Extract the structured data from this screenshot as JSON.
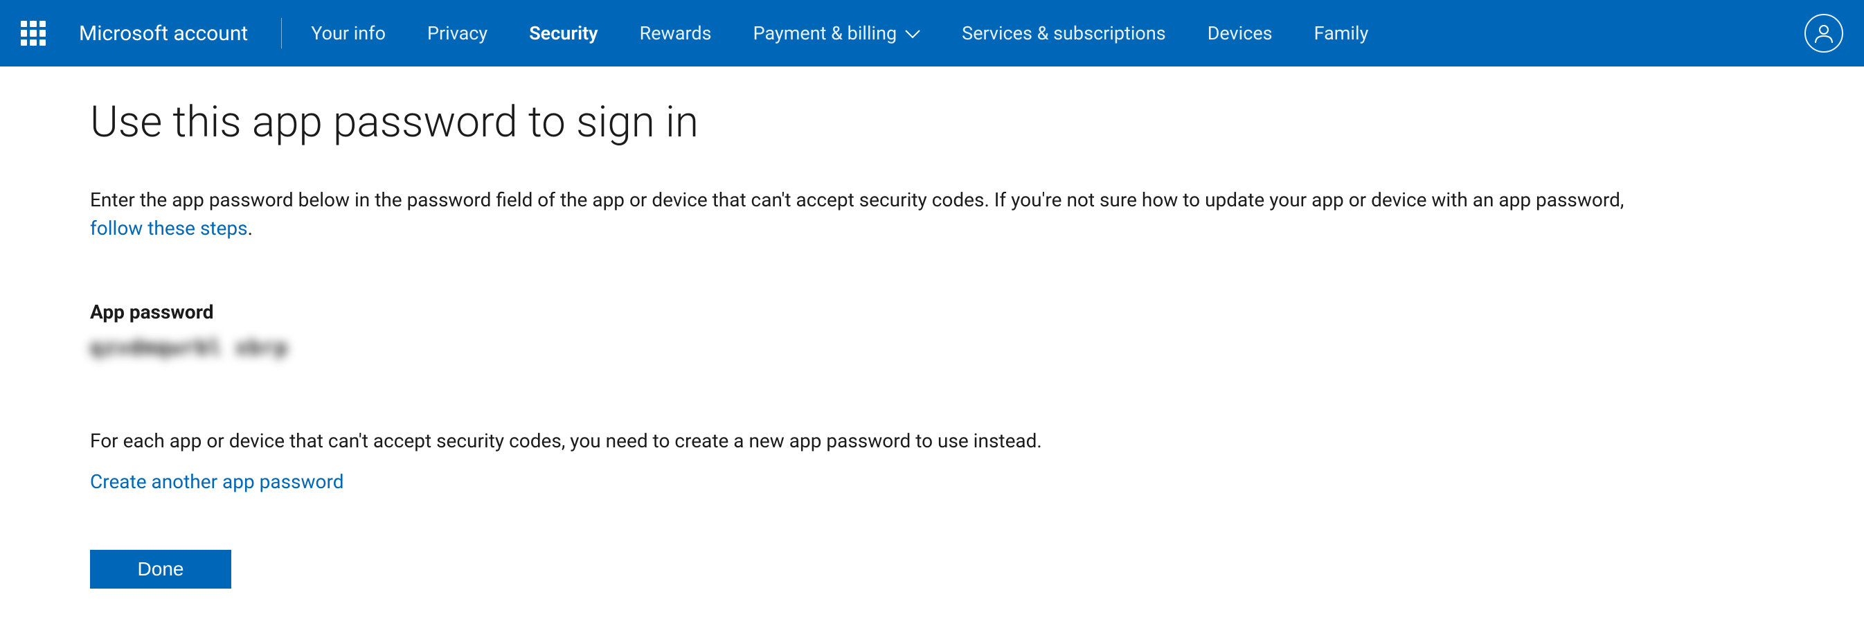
{
  "header": {
    "brand": "Microsoft account",
    "nav": {
      "your_info": "Your info",
      "privacy": "Privacy",
      "security": "Security",
      "rewards": "Rewards",
      "payment": "Payment & billing",
      "services": "Services & subscriptions",
      "devices": "Devices",
      "family": "Family"
    }
  },
  "main": {
    "title": "Use this app password to sign in",
    "intro_text": "Enter the app password below in the password field of the app or device that can't accept security codes. If you're not sure how to update your app or device with an app password, ",
    "intro_link": "follow these steps",
    "intro_period": ".",
    "password_label": "App password",
    "password_value": "qzvdmqwrbl xbrp",
    "note": "For each app or device that can't accept security codes, you need to create a new app password to use instead.",
    "create_link": "Create another app password",
    "done_button": "Done"
  }
}
